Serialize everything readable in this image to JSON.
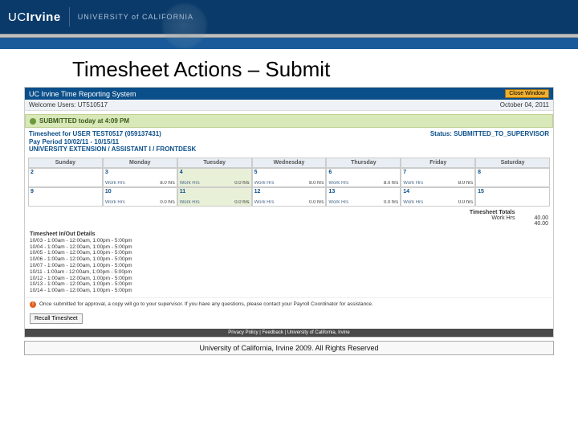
{
  "brand": {
    "uc": "UC",
    "irvine": "Irvine",
    "univ": "UNIVERSITY of CALIFORNIA"
  },
  "slide": {
    "title": "Timesheet Actions – Submit",
    "footer": "University of California, Irvine 2009. All Rights Reserved"
  },
  "app": {
    "title": "UC Irvine Time Reporting System",
    "close": "Close Window",
    "welcome": "Welcome Users: UT510517",
    "date": "October 04, 2011",
    "submitted": "SUBMITTED today at 4:09 PM",
    "emp_line1": "Timesheet for USER TEST0517 (059137431)",
    "emp_line2": "Pay Period 10/02/11 - 10/15/11",
    "emp_line3": "UNIVERSITY EXTENSION / ASSISTANT I / FRONTDESK",
    "status": "Status: SUBMITTED_TO_SUPERVISOR",
    "days": [
      "Sunday",
      "Monday",
      "Tuesday",
      "Wednesday",
      "Thursday",
      "Friday",
      "Saturday"
    ],
    "week1": [
      {
        "d": "2",
        "lbl": "",
        "v": ""
      },
      {
        "d": "3",
        "lbl": "Work Hrs",
        "v": "8.0 hrs"
      },
      {
        "d": "4",
        "lbl": "Work Hrs",
        "v": "0.0 hrs",
        "hl": true
      },
      {
        "d": "5",
        "lbl": "Work Hrs",
        "v": "8.0 hrs"
      },
      {
        "d": "6",
        "lbl": "Work Hrs",
        "v": "8.0 hrs"
      },
      {
        "d": "7",
        "lbl": "Work Hrs",
        "v": "8.0 hrs"
      },
      {
        "d": "8",
        "lbl": "",
        "v": ""
      }
    ],
    "week2": [
      {
        "d": "9",
        "lbl": "",
        "v": ""
      },
      {
        "d": "10",
        "lbl": "Work Hrs",
        "v": "0.0 hrs"
      },
      {
        "d": "11",
        "lbl": "Work Hrs",
        "v": "0.0 hrs",
        "hl": true
      },
      {
        "d": "12",
        "lbl": "Work Hrs",
        "v": "0.0 hrs"
      },
      {
        "d": "13",
        "lbl": "Work Hrs",
        "v": "0.0 hrs"
      },
      {
        "d": "14",
        "lbl": "Work Hrs",
        "v": "0.0 hrs"
      },
      {
        "d": "15",
        "lbl": "",
        "v": ""
      }
    ],
    "totals_title": "Timesheet Totals",
    "totals_label": "Work Hrs",
    "totals_v1": "40.00",
    "totals_v2": "40.00",
    "details_title": "Timesheet In/Out Details",
    "details_lines": [
      "10/03 - 1:00am - 12:00am, 1:00pm - 5:00pm",
      "10/04 - 1:00am - 12:00am, 1:00pm - 5:00pm",
      "10/05 - 1:00am - 12:00am, 1:00pm - 5:00pm",
      "10/06 - 1:00am - 12:00am, 1:00pm - 5:00pm",
      "10/07 - 1:00am - 12:00am, 1:00pm - 5:00pm",
      "10/11 - 1:00am - 12:00am, 1:00pm - 5:00pm",
      "10/12 - 1:00am - 12:00am, 1:00pm - 5:00pm",
      "10/13 - 1:00am - 12:00am, 1:00pm - 5:00pm",
      "10/14 - 1:00am - 12:00am, 1:00pm - 5:00pm"
    ],
    "warn": "Once submitted for approval, a copy will go to your supervisor. If you have any questions, please contact your Payroll Coordinator for assistance.",
    "recall": "Recall Timesheet",
    "footer_links": "Privacy Policy  |  Feedback  |  University of California, Irvine"
  }
}
